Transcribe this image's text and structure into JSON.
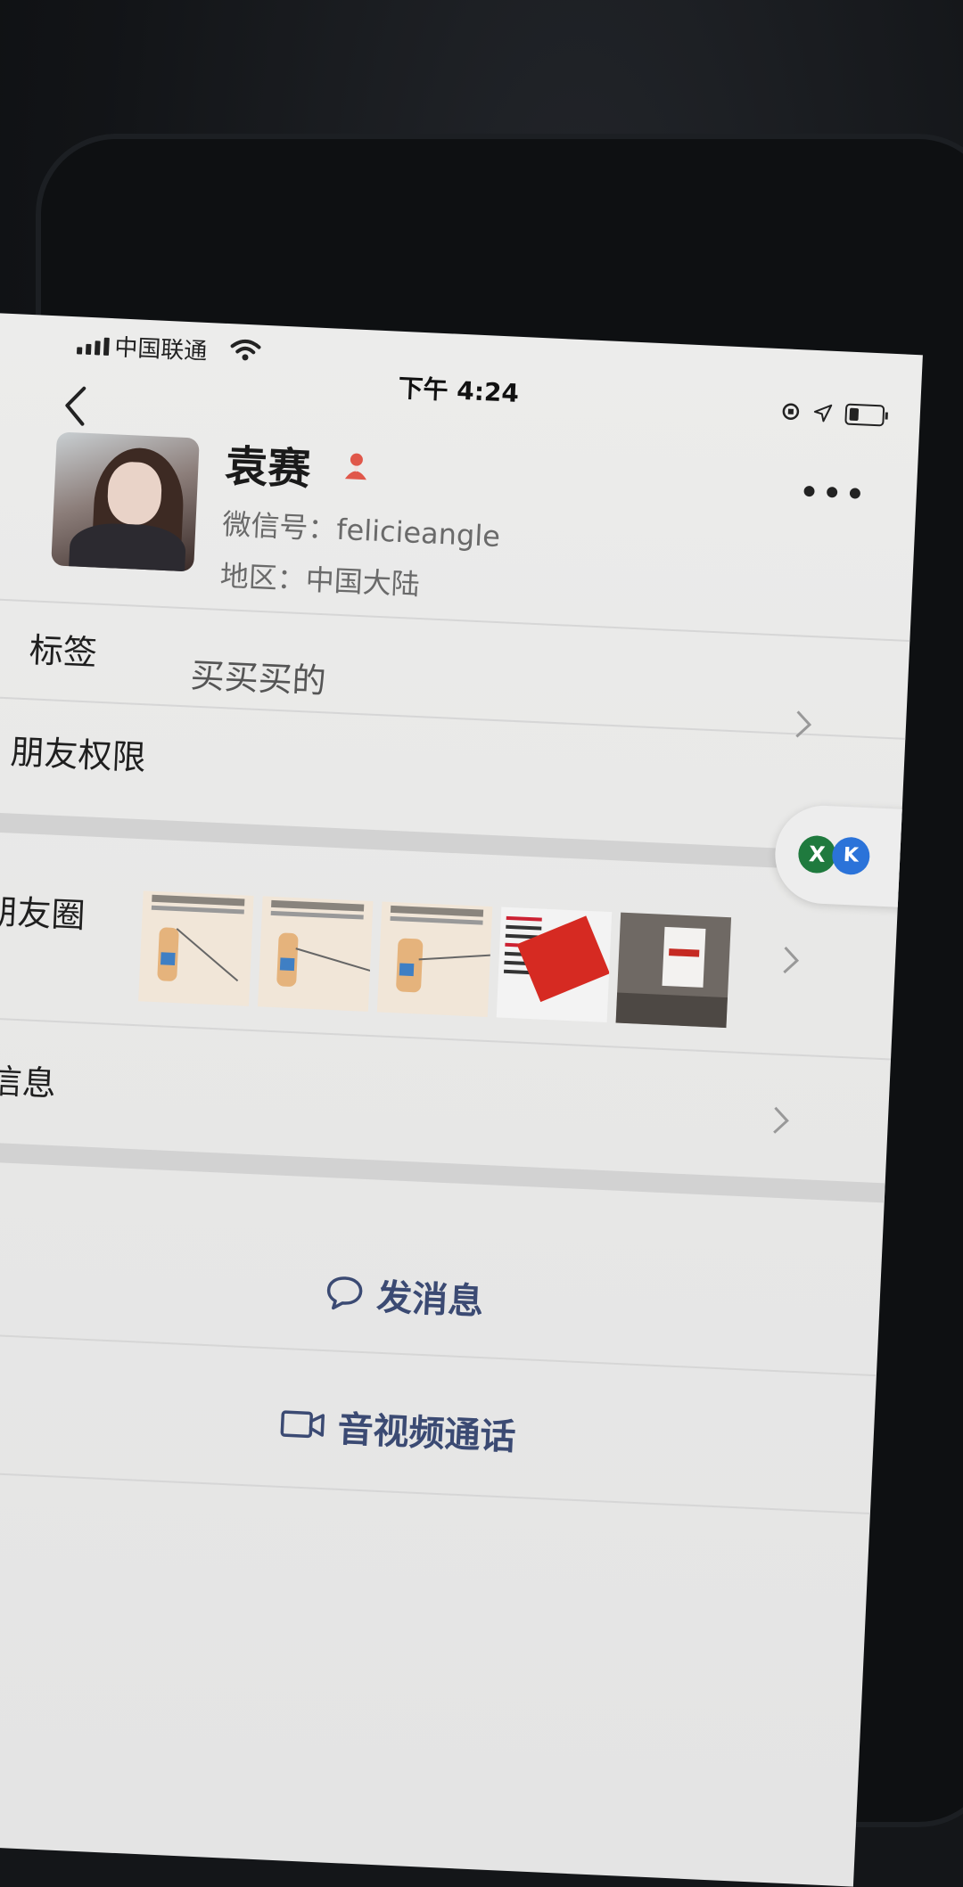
{
  "status_bar": {
    "carrier": "中国联通",
    "time": "下午 4:24"
  },
  "profile": {
    "name": "袁赛",
    "wechat_id_label": "微信号：felicieangle",
    "region_label": "地区：中国大陆"
  },
  "rows": {
    "tags_label": "标签",
    "tags_value": "买买买的",
    "permissions_label": "朋友权限",
    "moments_label": "朋友圈",
    "more_info_label": "更多信息"
  },
  "actions": {
    "send_message": "发消息",
    "video_call": "音视频通话"
  },
  "floating_pill": {
    "left_badge": "X",
    "right_badge": "K"
  },
  "colors": {
    "action_text": "#3b4a73",
    "gender_female": "#e0574a"
  }
}
